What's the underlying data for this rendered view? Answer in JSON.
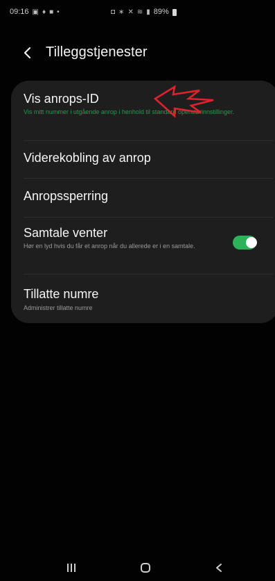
{
  "status_bar": {
    "time": "09:16",
    "battery_percent": "89%",
    "left_icons": [
      "gallery-icon",
      "location-icon",
      "message-icon",
      "dot-icon"
    ],
    "right_icons": [
      "nfc-icon",
      "bluetooth-icon",
      "mute-icon",
      "wifi-icon",
      "signal-icon"
    ]
  },
  "header": {
    "title": "Tilleggstjenester",
    "back_icon": "chevron-left-icon"
  },
  "settings": {
    "items": [
      {
        "title": "Vis anrops-ID",
        "subtitle": "Vis mitt nummer i utgående anrop i henhold til standard operatørinnstillinger.",
        "subtitle_color": "#1f9c4f"
      },
      {
        "title": "Viderekobling av anrop"
      },
      {
        "title": "Anropssperring"
      },
      {
        "title": "Samtale venter",
        "subtitle": "Hør en lyd hvis du får et anrop når du allerede er i en samtale.",
        "toggle_on": true
      },
      {
        "title": "Tillatte numre",
        "subtitle": "Administrer tillatte numre"
      }
    ]
  },
  "annotation": {
    "type": "arrow",
    "color": "#e0222a"
  },
  "colors": {
    "background": "#020202",
    "card": "#1e1e1e",
    "accent_green": "#2bb35a",
    "subtitle_green": "#1f9c4f"
  },
  "nav_bar": {
    "icons": [
      "recents-icon",
      "home-icon",
      "back-icon"
    ]
  }
}
